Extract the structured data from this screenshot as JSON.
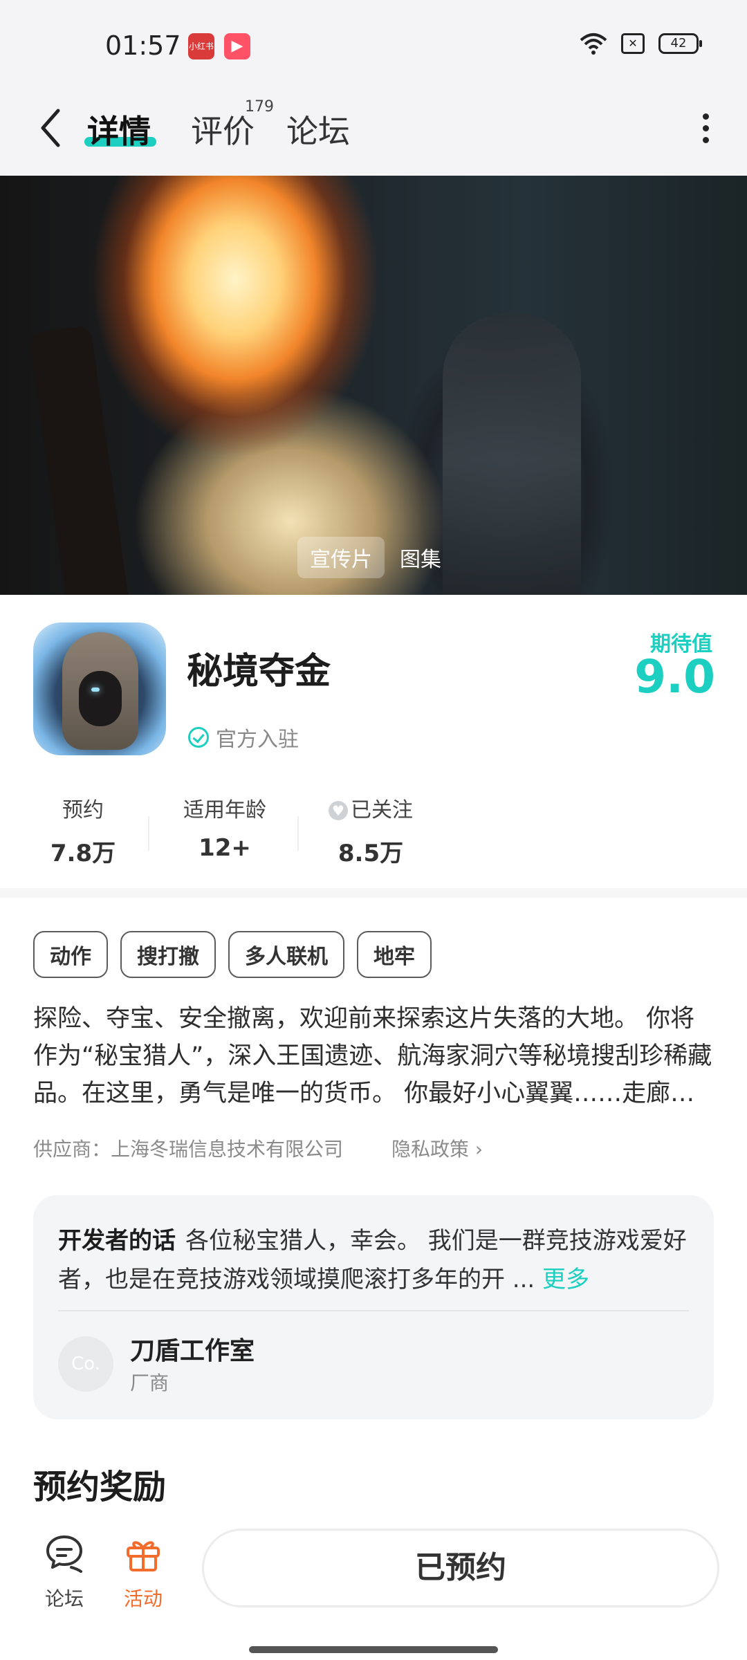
{
  "status": {
    "time": "01:57",
    "battery": "42",
    "app_icon_1": "小红书",
    "app_icon_2": "▶"
  },
  "nav": {
    "tab_detail": "详情",
    "tab_review": "评价",
    "review_count": "179",
    "tab_forum": "论坛"
  },
  "hero": {
    "tab_video": "宣传片",
    "tab_gallery": "图集"
  },
  "app": {
    "name": "秘境夺金",
    "official": "官方入驻",
    "expect_label": "期待值",
    "expect_value": "9.0",
    "accent_color": "#1ccfc0"
  },
  "stats": [
    {
      "label": "预约",
      "value": "7.8万"
    },
    {
      "label": "适用年龄",
      "value": "12+"
    },
    {
      "label": "已关注",
      "value": "8.5万"
    }
  ],
  "tags": [
    "动作",
    "搜打撤",
    "多人联机",
    "地牢"
  ],
  "description": "探险、夺宝、安全撤离，欢迎前来探索这片失落的大地。 你将作为“秘宝猎人”，深入王国遗迹、航海家洞穴等秘境搜刮珍稀藏品。在这里，勇气是唯一的货币。 你最好小心翼翼……走廊…",
  "supplier": "供应商：上海冬瑞信息技术有限公司",
  "privacy": "隐私政策",
  "developer": {
    "title": "开发者的话",
    "text": "各位秘宝猎人，幸会。 我们是一群竞技游戏爱好者，也是在竞技游戏领域摸爬滚打多年的开 ...",
    "more": "更多",
    "avatar_text": "Co.",
    "studio": "刀盾工作室",
    "role": "厂商"
  },
  "reward_title": "预约奖励",
  "bottom": {
    "forum_label": "论坛",
    "activity_label": "活动",
    "reserve_label": "已预约",
    "activity_color": "#f26c2c"
  }
}
